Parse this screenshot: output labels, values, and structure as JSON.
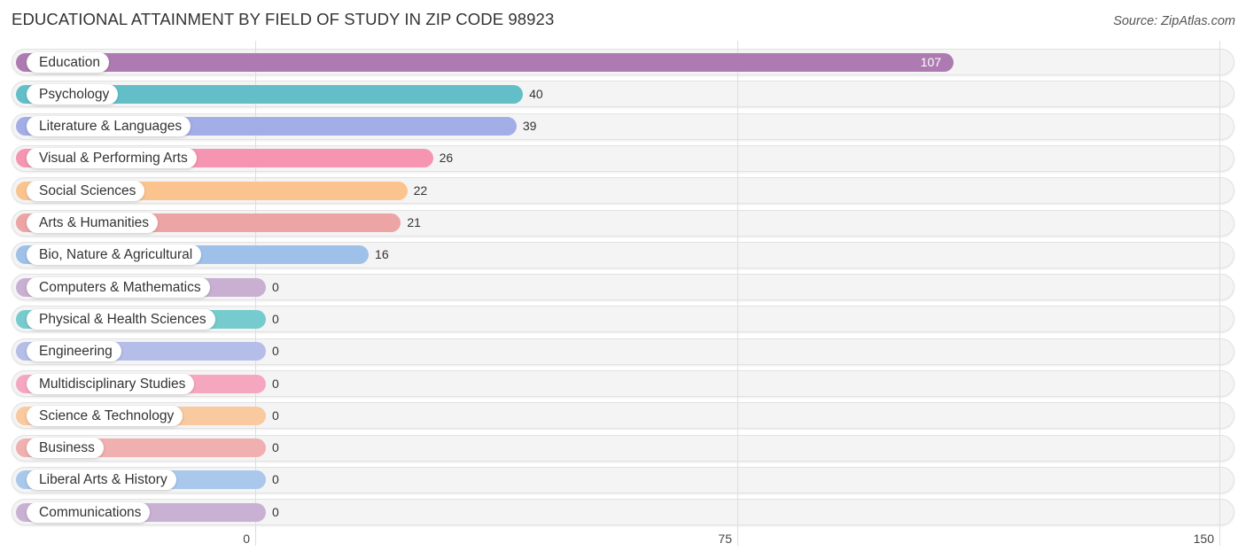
{
  "header": {
    "title": "EDUCATIONAL ATTAINMENT BY FIELD OF STUDY IN ZIP CODE 98923",
    "source": "Source: ZipAtlas.com"
  },
  "chart_data": {
    "type": "bar",
    "orientation": "horizontal",
    "title": "EDUCATIONAL ATTAINMENT BY FIELD OF STUDY IN ZIP CODE 98923",
    "source": "Source: ZipAtlas.com",
    "xlabel": "",
    "ylabel": "",
    "xlim": [
      0,
      150
    ],
    "ticks": [
      0,
      75,
      150
    ],
    "tick_labels": [
      "0",
      "75",
      "150"
    ],
    "grid": true,
    "categories": [
      "Education",
      "Psychology",
      "Literature & Languages",
      "Visual & Performing Arts",
      "Social Sciences",
      "Arts & Humanities",
      "Bio, Nature & Agricultural",
      "Computers & Mathematics",
      "Physical & Health Sciences",
      "Engineering",
      "Multidisciplinary Studies",
      "Science & Technology",
      "Business",
      "Liberal Arts & History",
      "Communications"
    ],
    "values": [
      107,
      40,
      39,
      26,
      22,
      21,
      16,
      0,
      0,
      0,
      0,
      0,
      0,
      0,
      0
    ],
    "value_labels": [
      "107",
      "40",
      "39",
      "26",
      "22",
      "21",
      "16",
      "0",
      "0",
      "0",
      "0",
      "0",
      "0",
      "0",
      "0"
    ],
    "colors": [
      "#ad7bb2",
      "#62bfc8",
      "#a3ade6",
      "#f595b2",
      "#fbc48f",
      "#eda4a4",
      "#9fc1e9",
      "#c9afd1",
      "#75cbcd",
      "#b5bde9",
      "#f6a7c0",
      "#f9c99f",
      "#f0b0b0",
      "#a9c8ec",
      "#c9b1d4"
    ]
  }
}
